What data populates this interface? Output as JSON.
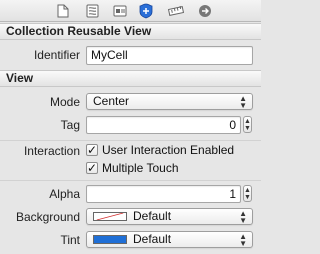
{
  "tabs": [
    {
      "icon": "file-icon"
    },
    {
      "icon": "quick-help-icon"
    },
    {
      "icon": "identity-icon"
    },
    {
      "icon": "attributes-icon",
      "active": true
    },
    {
      "icon": "ruler-icon"
    },
    {
      "icon": "connections-icon"
    }
  ],
  "collection_reusable_view": {
    "title": "Collection Reusable View",
    "identifier_label": "Identifier",
    "identifier_value": "MyCell"
  },
  "view": {
    "title": "View",
    "mode_label": "Mode",
    "mode_value": "Center",
    "tag_label": "Tag",
    "tag_value": "0",
    "interaction_label": "Interaction",
    "user_interaction_label": "User Interaction Enabled",
    "user_interaction_checked": true,
    "multiple_touch_label": "Multiple Touch",
    "multiple_touch_checked": true,
    "alpha_label": "Alpha",
    "alpha_value": "1",
    "background_label": "Background",
    "background_value": "Default",
    "tint_label": "Tint",
    "tint_value": "Default",
    "tint_color": "#1f6fd6",
    "check_glyph": "✓",
    "up_arrow": "▲",
    "down_arrow": "▼"
  }
}
